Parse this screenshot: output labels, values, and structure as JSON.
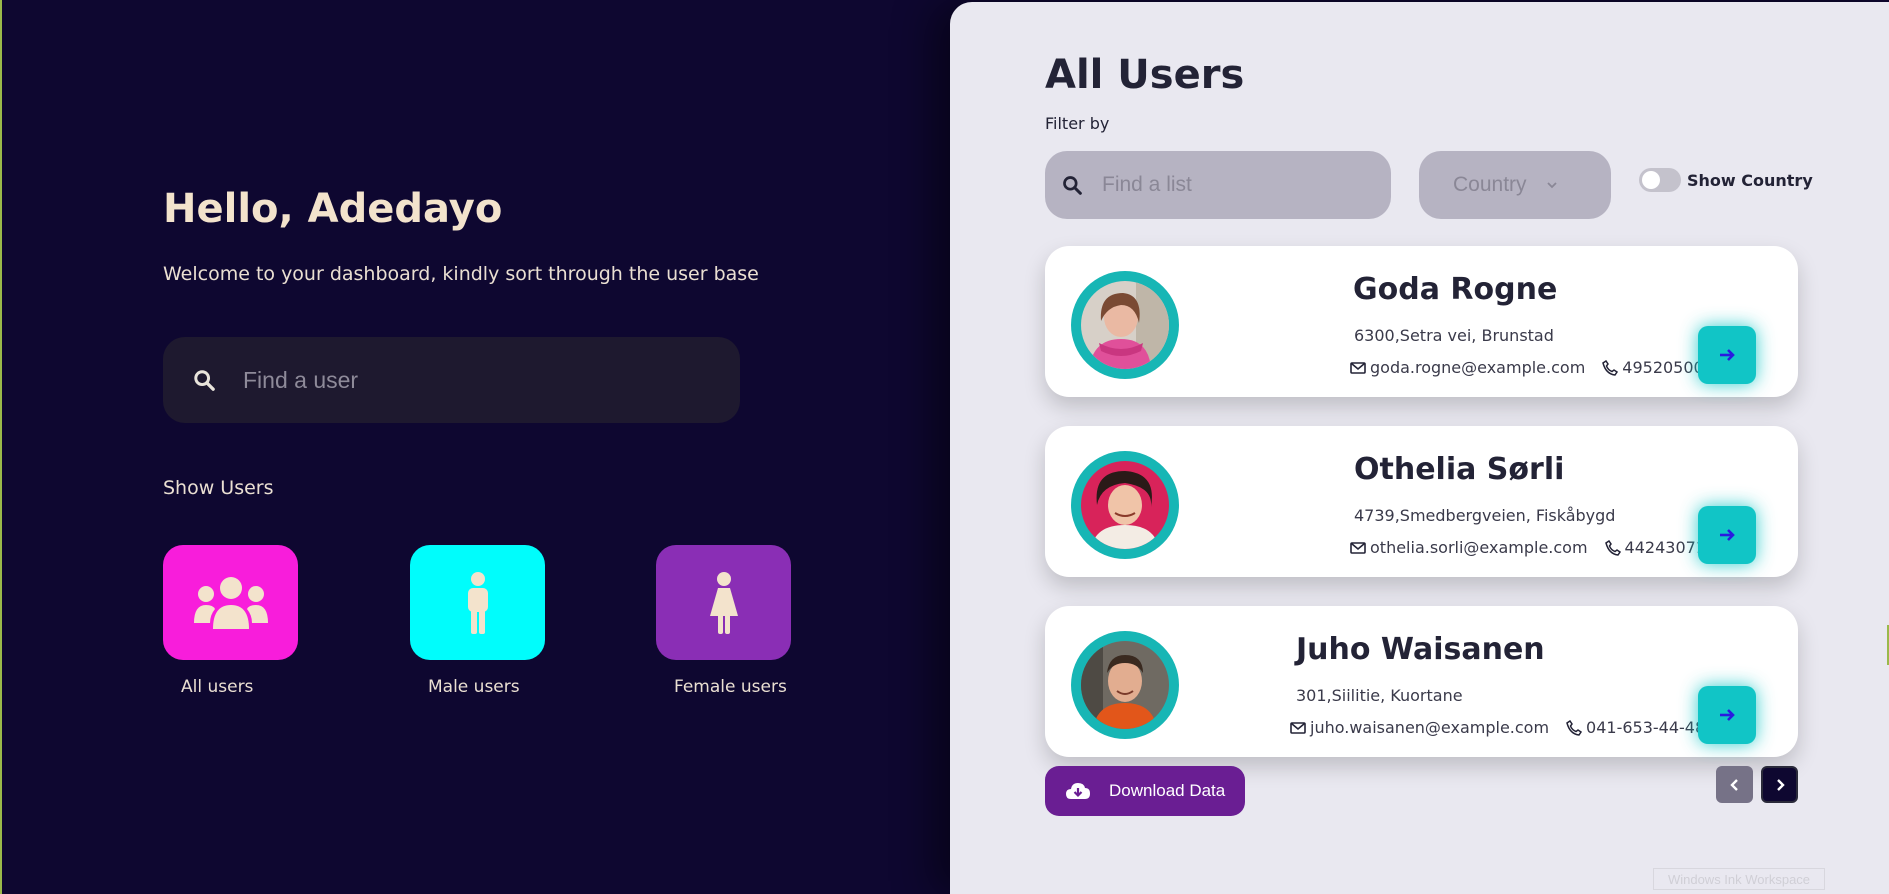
{
  "dashboard": {
    "greeting": "Hello, Adedayo",
    "welcome": "Welcome to your dashboard, kindly sort through the user base",
    "search_placeholder": "Find a user",
    "show_users_label": "Show Users",
    "categories": [
      {
        "label": "All users",
        "icon": "users-group-icon",
        "color": "#f81ddb"
      },
      {
        "label": "Male users",
        "icon": "male-icon",
        "color": "#00fdfc"
      },
      {
        "label": "Female users",
        "icon": "female-icon",
        "color": "#8a2eb5"
      }
    ]
  },
  "users_panel": {
    "title": "All Users",
    "filter_label": "Filter by",
    "search_placeholder": "Find a list",
    "country_select": "Country",
    "show_country_label": "Show Country",
    "show_country_on": false,
    "users": [
      {
        "name": "Goda Rogne",
        "address": "6300,Setra vei, Brunstad",
        "email": "goda.rogne@example.com",
        "phone": "49520500"
      },
      {
        "name": "Othelia Sørli",
        "address": "4739,Smedbergveien, Fiskåbygd",
        "email": "othelia.sorli@example.com",
        "phone": "44243071"
      },
      {
        "name": "Juho Waisanen",
        "address": "301,Siilitie, Kuortane",
        "email": "juho.waisanen@example.com",
        "phone": "041-653-44-48"
      }
    ],
    "download_label": "Download Data",
    "watermark": "Windows Ink Workspace"
  },
  "colors": {
    "background": "#0e0730",
    "accent_teal": "#11c5c6",
    "download_purple": "#6a1e93"
  }
}
